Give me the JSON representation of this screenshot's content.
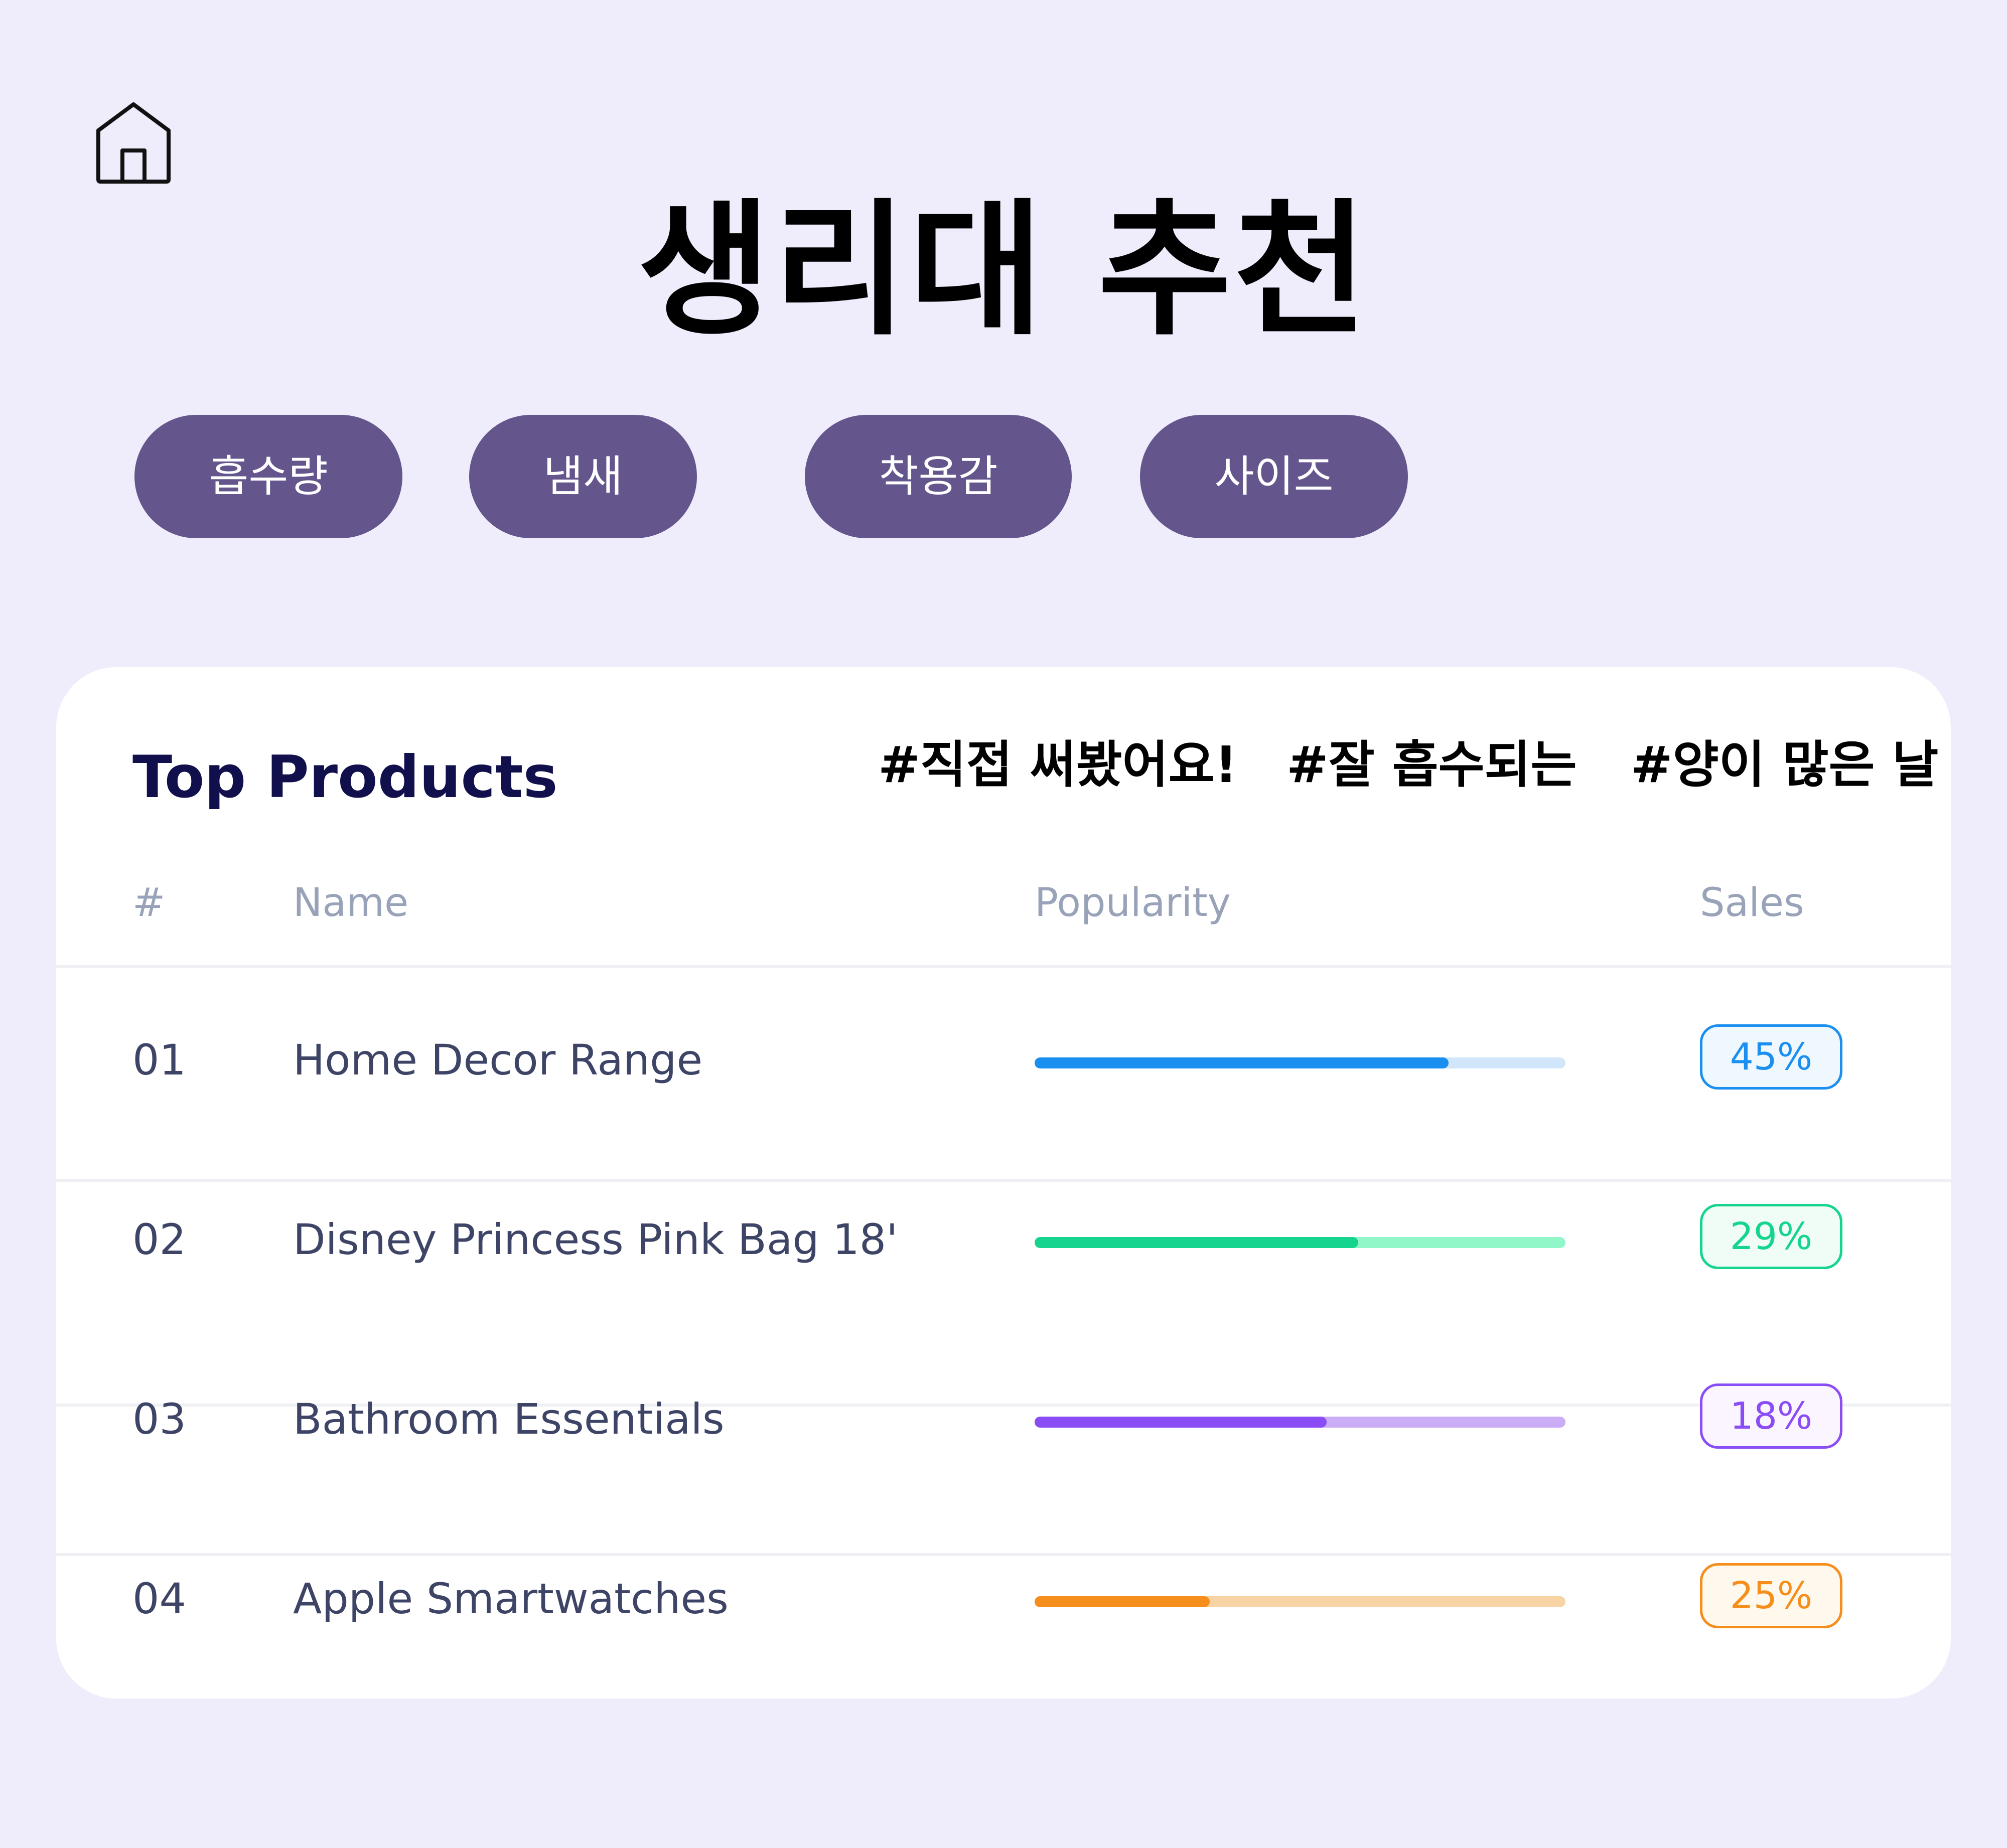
{
  "page": {
    "title": "생리대 추천",
    "home_icon": "home-icon"
  },
  "filters": [
    {
      "label": "흡수량"
    },
    {
      "label": "냄새"
    },
    {
      "label": "착용감"
    },
    {
      "label": "사이즈"
    }
  ],
  "card": {
    "title": "Top Products",
    "hashtags": [
      "#직접 써봤어요!",
      "#잘 흡수되는",
      "#양이 많은 날"
    ],
    "columns": {
      "number": "#",
      "name": "Name",
      "popularity": "Popularity",
      "sales": "Sales"
    },
    "rows": [
      {
        "number": "01",
        "name": "Home Decor Range",
        "popularity": 0.78,
        "sales": "45%",
        "fill_color": "#1a8ff0",
        "track_color": "#d1e6fa",
        "badge_bg": "#f0f8ff"
      },
      {
        "number": "02",
        "name": "Disney Princess Pink Bag 18'",
        "popularity": 0.61,
        "sales": "29%",
        "fill_color": "#14d48e",
        "track_color": "#92f7c8",
        "badge_bg": "#f0fdf7"
      },
      {
        "number": "03",
        "name": "Bathroom Essentials",
        "popularity": 0.55,
        "sales": "18%",
        "fill_color": "#8a4cf5",
        "track_color": "#caacf7",
        "badge_bg": "#faf5ff"
      },
      {
        "number": "04",
        "name": "Apple Smartwatches",
        "popularity": 0.33,
        "sales": "25%",
        "fill_color": "#f58e1a",
        "track_color": "#f8d3a4",
        "badge_bg": "#fff8ec"
      }
    ]
  }
}
